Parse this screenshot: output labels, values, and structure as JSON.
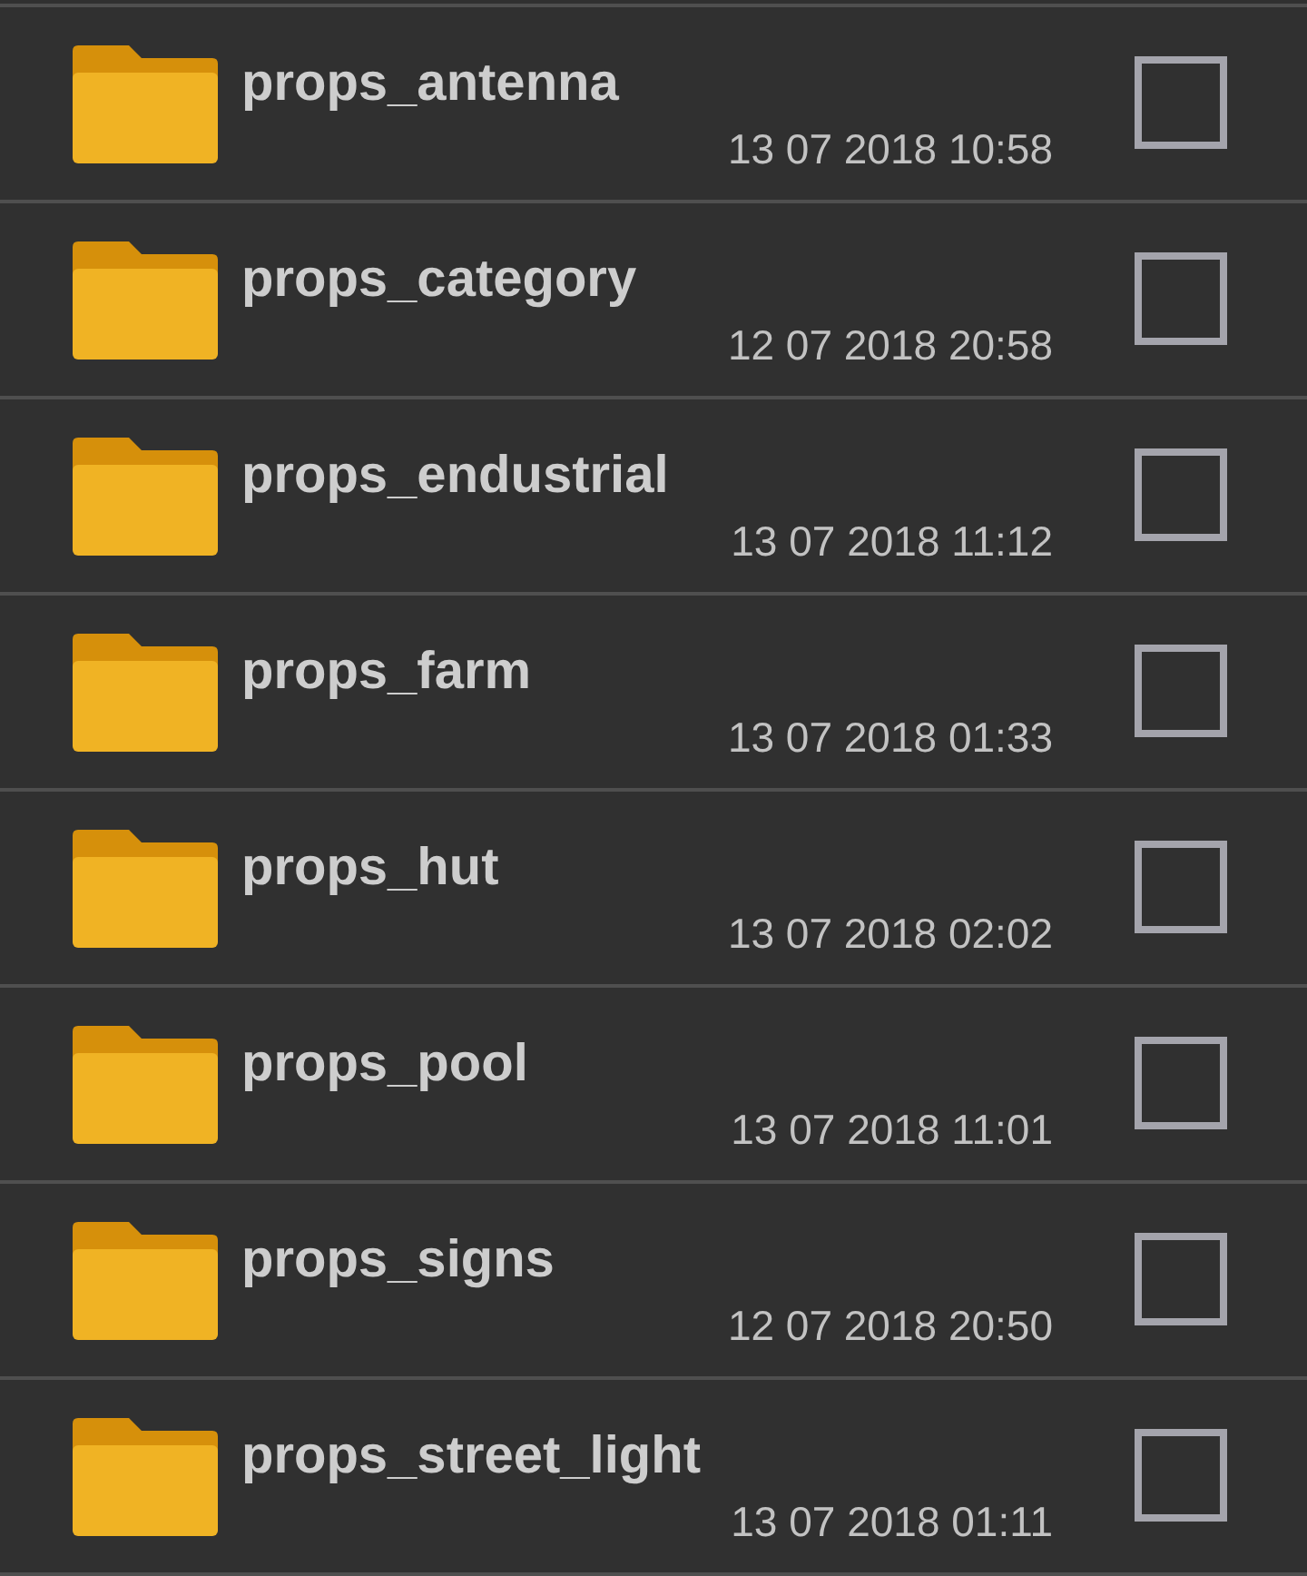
{
  "folders": [
    {
      "name": "props_antenna",
      "date": "13 07 2018 10:58",
      "checked": false
    },
    {
      "name": "props_category",
      "date": "12 07 2018 20:58",
      "checked": false
    },
    {
      "name": "props_endustrial",
      "date": "13 07 2018 11:12",
      "checked": false
    },
    {
      "name": "props_farm",
      "date": "13 07 2018 01:33",
      "checked": false
    },
    {
      "name": "props_hut",
      "date": "13 07 2018 02:02",
      "checked": false
    },
    {
      "name": "props_pool",
      "date": "13 07 2018 11:01",
      "checked": false
    },
    {
      "name": "props_signs",
      "date": "12 07 2018 20:50",
      "checked": false
    },
    {
      "name": "props_street_light",
      "date": "13 07 2018 01:11",
      "checked": false
    }
  ]
}
